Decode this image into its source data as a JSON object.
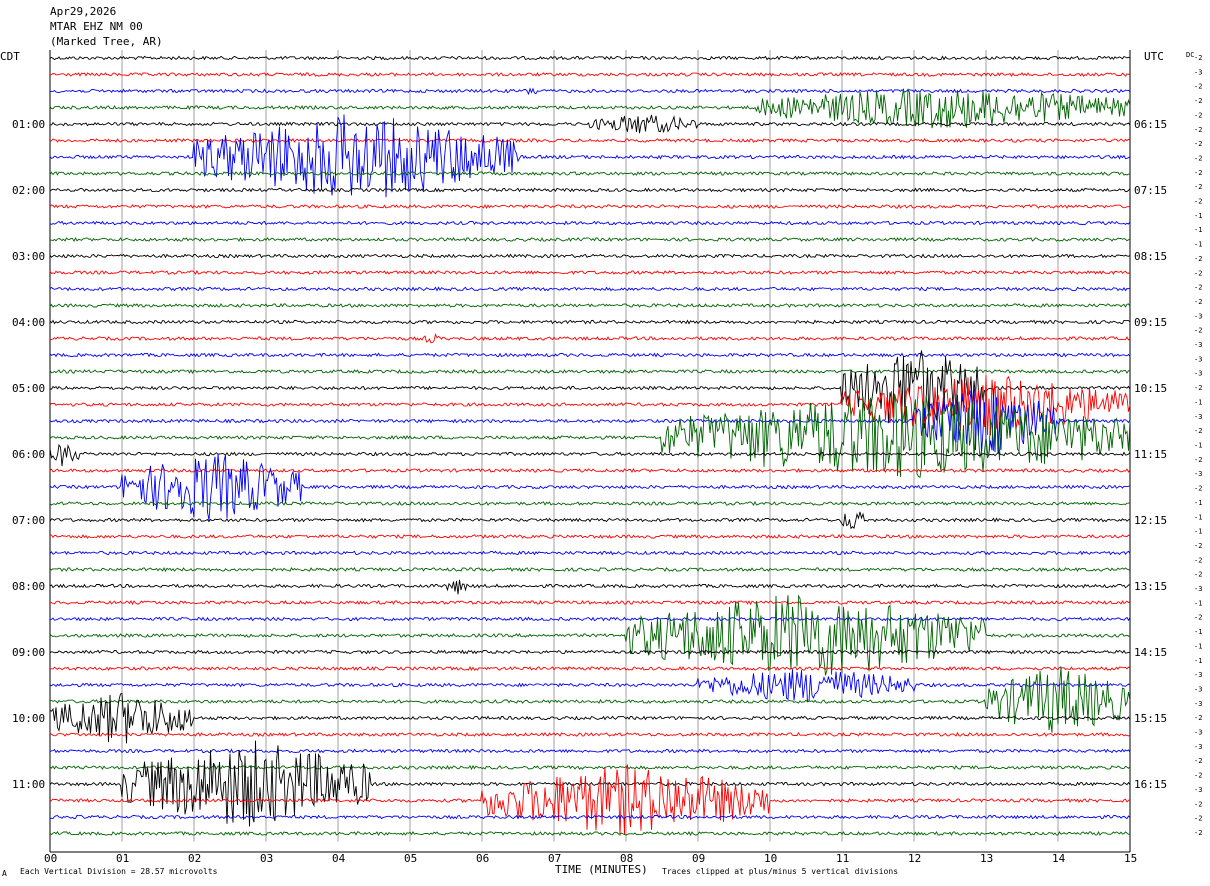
{
  "header": {
    "line1": "Apr29,2026",
    "line2": "MTAR EHZ NM 00",
    "line3": "(Marked Tree, AR)"
  },
  "left_tz": "CDT",
  "right_tz": "UTC",
  "dc_label": "DC",
  "footer": {
    "scale": "Each Vertical Division =   28.57 microvolts",
    "xlabel": "TIME (MINUTES)",
    "clip": "Traces clipped at plus/minus 5 vertical divisions",
    "corner": "A"
  },
  "colors": {
    "trace": [
      "#000000",
      "#ff0000",
      "#0000ff",
      "#006400"
    ],
    "grid": "#a0a0a0"
  },
  "chart_data": {
    "type": "line",
    "title": "",
    "xlabel": "TIME (MINUTES)",
    "x_ticks": [
      "00",
      "01",
      "02",
      "03",
      "04",
      "05",
      "06",
      "07",
      "08",
      "09",
      "10",
      "11",
      "12",
      "13",
      "14",
      "15"
    ],
    "xlim": [
      0,
      15
    ],
    "rows_count": 48,
    "row_minutes": 15,
    "left_time_labels": [
      "01:00",
      "02:00",
      "03:00",
      "04:00",
      "05:00",
      "06:00",
      "07:00",
      "08:00",
      "09:00",
      "10:00",
      "11:00"
    ],
    "right_time_labels": [
      "06:15",
      "07:15",
      "08:15",
      "09:15",
      "10:15",
      "11:15",
      "12:15",
      "13:15",
      "14:15",
      "15:15",
      "16:15"
    ],
    "dc_offsets": [
      "-2",
      "-3",
      "-2",
      "-2",
      "-2",
      "-2",
      "-2",
      "-2",
      "-2",
      "-2",
      "-2",
      "-1",
      "-1",
      "-1",
      "-2",
      "-2",
      "-2",
      "-2",
      "-3",
      "-2",
      "-3",
      "-3",
      "-3",
      "-2",
      "-1",
      "-3",
      "-2",
      "-1",
      "-2",
      "-3",
      "-2",
      "-1",
      "-1",
      "-1",
      "-2",
      "-2",
      "-2",
      "-3",
      "-1",
      "-2",
      "-1",
      "-1",
      "-1",
      "-3",
      "-3",
      "-3",
      "-2",
      "-3",
      "-3",
      "-2",
      "-2",
      "-3",
      "-2",
      "-2",
      "-2"
    ],
    "events": [
      {
        "row": 2,
        "start_min": 6.6,
        "end_min": 6.8,
        "amplitude": 0.6
      },
      {
        "row": 3,
        "start_min": 9.8,
        "end_min": 15.0,
        "amplitude": 2.4
      },
      {
        "row": 4,
        "start_min": 7.5,
        "end_min": 9.0,
        "amplitude": 1.2
      },
      {
        "row": 6,
        "start_min": 2.0,
        "end_min": 6.5,
        "amplitude": 5.0
      },
      {
        "row": 17,
        "start_min": 5.2,
        "end_min": 5.4,
        "amplitude": 0.7
      },
      {
        "row": 20,
        "start_min": 11.0,
        "end_min": 13.0,
        "amplitude": 5.0
      },
      {
        "row": 21,
        "start_min": 11.0,
        "end_min": 15.0,
        "amplitude": 3.5
      },
      {
        "row": 22,
        "start_min": 12.0,
        "end_min": 14.0,
        "amplitude": 4.0
      },
      {
        "row": 23,
        "start_min": 8.5,
        "end_min": 15.0,
        "amplitude": 5.0
      },
      {
        "row": 24,
        "start_min": 0.0,
        "end_min": 0.4,
        "amplitude": 1.5
      },
      {
        "row": 26,
        "start_min": 1.0,
        "end_min": 3.5,
        "amplitude": 4.0
      },
      {
        "row": 28,
        "start_min": 11.0,
        "end_min": 11.3,
        "amplitude": 1.5
      },
      {
        "row": 32,
        "start_min": 5.5,
        "end_min": 5.8,
        "amplitude": 1.0
      },
      {
        "row": 35,
        "start_min": 8.0,
        "end_min": 13.0,
        "amplitude": 5.0
      },
      {
        "row": 38,
        "start_min": 9.0,
        "end_min": 12.0,
        "amplitude": 2.0
      },
      {
        "row": 39,
        "start_min": 13.0,
        "end_min": 15.0,
        "amplitude": 4.0
      },
      {
        "row": 40,
        "start_min": 0.0,
        "end_min": 2.0,
        "amplitude": 3.0
      },
      {
        "row": 44,
        "start_min": 1.0,
        "end_min": 4.5,
        "amplitude": 5.0
      },
      {
        "row": 45,
        "start_min": 6.0,
        "end_min": 10.0,
        "amplitude": 4.0
      }
    ]
  }
}
